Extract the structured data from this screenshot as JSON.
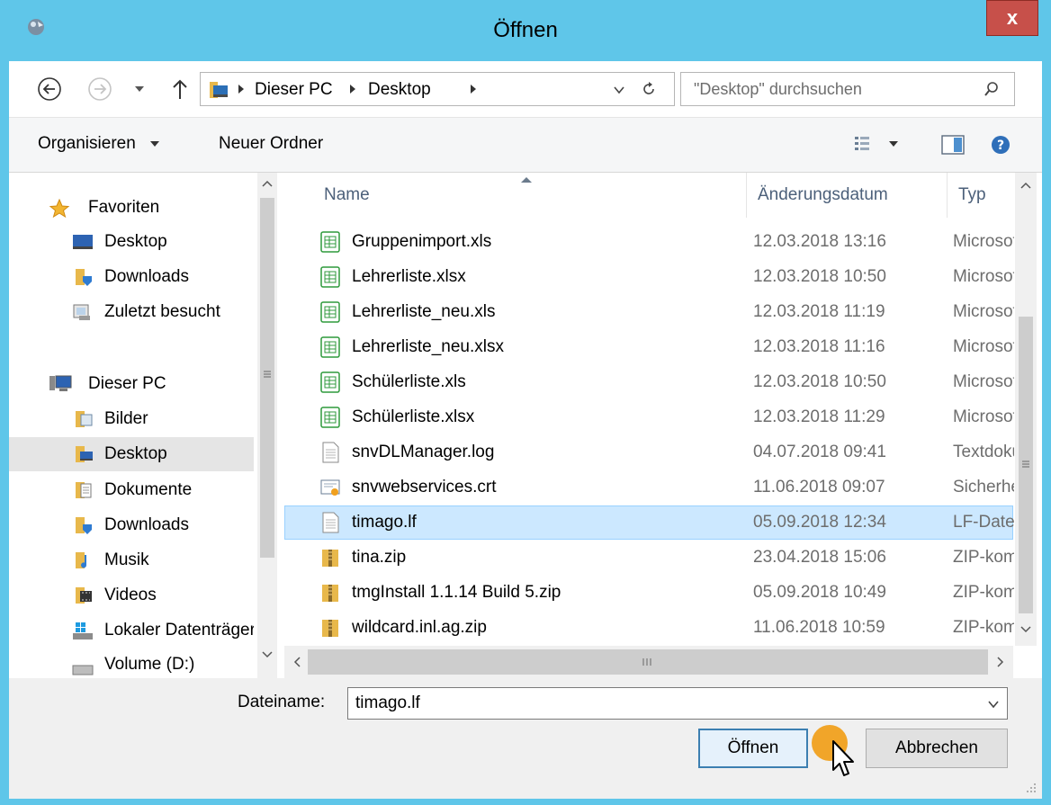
{
  "window": {
    "title": "Öffnen",
    "close_label": "x",
    "accent": "#5fc6e9"
  },
  "address": {
    "crumbs": [
      "Dieser PC",
      "Desktop"
    ],
    "search_placeholder": "\"Desktop\" durchsuchen"
  },
  "toolbar": {
    "organize_label": "Organisieren",
    "new_folder_label": "Neuer Ordner"
  },
  "nav": {
    "items": [
      {
        "label": "Favoriten",
        "icon": "star-icon"
      },
      {
        "label": "Desktop",
        "icon": "desktop-icon"
      },
      {
        "label": "Downloads",
        "icon": "downloads-folder-icon"
      },
      {
        "label": "Zuletzt besucht",
        "icon": "recent-places-icon"
      },
      {
        "label": "Dieser PC",
        "icon": "computer-icon"
      },
      {
        "label": "Bilder",
        "icon": "pictures-folder-icon"
      },
      {
        "label": "Desktop",
        "icon": "desktop-folder-icon"
      },
      {
        "label": "Dokumente",
        "icon": "documents-folder-icon"
      },
      {
        "label": "Downloads",
        "icon": "downloads-folder-icon"
      },
      {
        "label": "Musik",
        "icon": "music-folder-icon"
      },
      {
        "label": "Videos",
        "icon": "videos-folder-icon"
      },
      {
        "label": "Lokaler Datenträger",
        "icon": "local-disk-icon"
      },
      {
        "label": "Volume (D:)",
        "icon": "drive-icon"
      }
    ],
    "selected_index": 6
  },
  "files": {
    "columns": {
      "name": "Name",
      "date": "Änderungsdatum",
      "type": "Typ"
    },
    "rows": [
      {
        "name": "Gruppenimport.xls",
        "date": "12.03.2018 13:16",
        "type": "Microsoft",
        "icon": "spreadsheet-icon"
      },
      {
        "name": "Lehrerliste.xlsx",
        "date": "12.03.2018 10:50",
        "type": "Microsoft",
        "icon": "spreadsheet-icon"
      },
      {
        "name": "Lehrerliste_neu.xls",
        "date": "12.03.2018 11:19",
        "type": "Microsoft",
        "icon": "spreadsheet-icon"
      },
      {
        "name": "Lehrerliste_neu.xlsx",
        "date": "12.03.2018 11:16",
        "type": "Microsoft",
        "icon": "spreadsheet-icon"
      },
      {
        "name": "Schülerliste.xls",
        "date": "12.03.2018 10:50",
        "type": "Microsoft",
        "icon": "spreadsheet-icon"
      },
      {
        "name": "Schülerliste.xlsx",
        "date": "12.03.2018 11:29",
        "type": "Microsoft",
        "icon": "spreadsheet-icon"
      },
      {
        "name": "snvDLManager.log",
        "date": "04.07.2018 09:41",
        "type": "Textdokument",
        "icon": "text-file-icon"
      },
      {
        "name": "snvwebservices.crt",
        "date": "11.06.2018 09:07",
        "type": "Sicherheitszertifikat",
        "icon": "certificate-icon"
      },
      {
        "name": "timago.lf",
        "date": "05.09.2018 12:34",
        "type": "LF-Datei",
        "icon": "text-file-icon"
      },
      {
        "name": "tina.zip",
        "date": "23.04.2018 15:06",
        "type": "ZIP-komprimiert",
        "icon": "zip-folder-icon"
      },
      {
        "name": "tmgInstall 1.1.14 Build 5.zip",
        "date": "05.09.2018 10:49",
        "type": "ZIP-komprimiert",
        "icon": "zip-folder-icon"
      },
      {
        "name": "wildcard.inl.ag.zip",
        "date": "11.06.2018 10:59",
        "type": "ZIP-komprimiert",
        "icon": "zip-folder-icon"
      }
    ],
    "selected_index": 8
  },
  "filename": {
    "label": "Dateiname:",
    "value": "timago.lf"
  },
  "buttons": {
    "open_label": "Öffnen",
    "cancel_label": "Abbrechen"
  },
  "cursor": {
    "highlight_color": "#f0a01e"
  }
}
